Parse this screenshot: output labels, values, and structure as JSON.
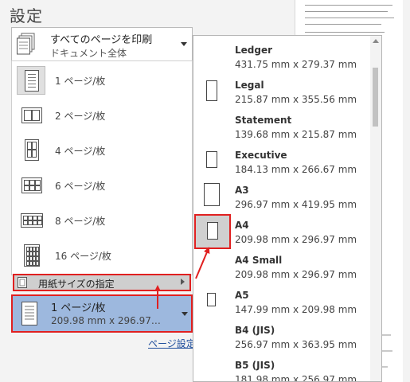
{
  "settings_title": "設定",
  "print_scope": {
    "title": "すべてのページを印刷",
    "subtitle": "ドキュメント全体"
  },
  "pages_per_sheet": {
    "items": [
      {
        "label": "1 ページ/枚"
      },
      {
        "label": "2 ページ/枚"
      },
      {
        "label": "4 ページ/枚"
      },
      {
        "label": "6 ページ/枚"
      },
      {
        "label": "8 ページ/枚"
      },
      {
        "label": "16 ページ/枚"
      }
    ],
    "selected_index": 0
  },
  "paper_spec_label": "用紙サイズの指定",
  "pps_button": {
    "title": "1 ページ/枚",
    "subtitle": "209.98 mm x 296.97…"
  },
  "page_setup_link": "ページ設定",
  "paper_sizes": [
    {
      "name": "Ledger",
      "dims": "431.75 mm x 279.37 mm"
    },
    {
      "name": "Legal",
      "dims": "215.87 mm x 355.56 mm"
    },
    {
      "name": "Statement",
      "dims": "139.68 mm x 215.87 mm"
    },
    {
      "name": "Executive",
      "dims": "184.13 mm x 266.67 mm"
    },
    {
      "name": "A3",
      "dims": "296.97 mm x 419.95 mm"
    },
    {
      "name": "A4",
      "dims": "209.98 mm x 296.97 mm"
    },
    {
      "name": "A4 Small",
      "dims": "209.98 mm x 296.97 mm"
    },
    {
      "name": "A5",
      "dims": "147.99 mm x 209.98 mm"
    },
    {
      "name": "B4 (JIS)",
      "dims": "256.97 mm x 363.95 mm"
    },
    {
      "name": "B5 (JIS)",
      "dims": "181.98 mm x 256.97 mm"
    }
  ],
  "selected_paper_index": 5,
  "colors": {
    "highlight_blue": "#9db8de",
    "annotation_red": "#e02020",
    "link_blue": "#1f4e9c"
  }
}
